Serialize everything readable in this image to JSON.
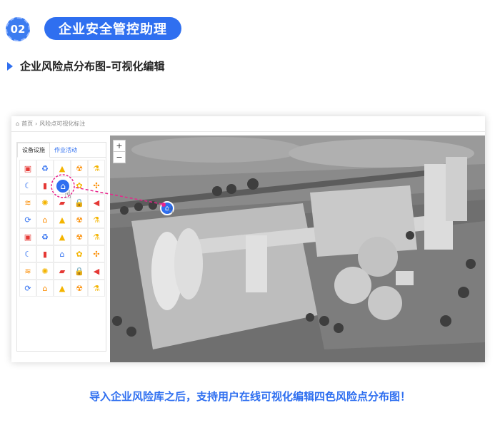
{
  "header": {
    "number": "02",
    "title": "企业安全管控助理"
  },
  "section": {
    "title": "企业风险点分布图–可视化编辑"
  },
  "app": {
    "breadcrumb": {
      "home": "首页",
      "separator": "›",
      "current": "风险点可视化标注"
    },
    "tabs": [
      {
        "label": "设备设施"
      },
      {
        "label": "作业活动"
      }
    ],
    "zoom": {
      "in": "+",
      "out": "−"
    },
    "palette": [
      [
        {
          "icon": "bed-icon",
          "color": "#e53935"
        },
        {
          "icon": "recycle-icon",
          "color": "#2f6ff0"
        },
        {
          "icon": "warning-icon",
          "color": "#f4b400"
        },
        {
          "icon": "radiation-icon",
          "color": "#fb8c00"
        },
        {
          "icon": "flask-icon",
          "color": "#f4b400"
        }
      ],
      [
        {
          "icon": "moon-icon",
          "color": "#2f6ff0"
        },
        {
          "icon": "extinguisher-icon",
          "color": "#e53935"
        },
        {
          "icon": "home-icon",
          "color": "#2f6ff0"
        },
        {
          "icon": "flower-icon",
          "color": "#f4b400"
        },
        {
          "icon": "fan-icon",
          "color": "#fb8c00"
        }
      ],
      [
        {
          "icon": "stack-icon",
          "color": "#fb8c00"
        },
        {
          "icon": "bulb-icon",
          "color": "#f4b400"
        },
        {
          "icon": "camera-icon",
          "color": "#e53935"
        },
        {
          "icon": "lock-icon",
          "color": "#2f6ff0"
        },
        {
          "icon": "speaker-icon",
          "color": "#e53935"
        }
      ],
      [
        {
          "icon": "cycle-icon",
          "color": "#2f6ff0"
        },
        {
          "icon": "house-icon",
          "color": "#fb8c00"
        },
        {
          "icon": "warning-icon",
          "color": "#f4b400"
        },
        {
          "icon": "radiation-icon",
          "color": "#fb8c00"
        },
        {
          "icon": "flask-icon",
          "color": "#f4b400"
        }
      ],
      [
        {
          "icon": "bed-icon",
          "color": "#e53935"
        },
        {
          "icon": "recycle-icon",
          "color": "#2f6ff0"
        },
        {
          "icon": "warning-icon",
          "color": "#f4b400"
        },
        {
          "icon": "radiation-icon",
          "color": "#fb8c00"
        },
        {
          "icon": "flask-icon",
          "color": "#f4b400"
        }
      ],
      [
        {
          "icon": "moon-icon",
          "color": "#2f6ff0"
        },
        {
          "icon": "extinguisher-icon",
          "color": "#e53935"
        },
        {
          "icon": "home-icon",
          "color": "#2f6ff0"
        },
        {
          "icon": "flower-icon",
          "color": "#f4b400"
        },
        {
          "icon": "fan-icon",
          "color": "#fb8c00"
        }
      ],
      [
        {
          "icon": "stack-icon",
          "color": "#fb8c00"
        },
        {
          "icon": "bulb-icon",
          "color": "#f4b400"
        },
        {
          "icon": "camera-icon",
          "color": "#e53935"
        },
        {
          "icon": "lock-icon",
          "color": "#2f6ff0"
        },
        {
          "icon": "speaker-icon",
          "color": "#e53935"
        }
      ],
      [
        {
          "icon": "cycle-icon",
          "color": "#2f6ff0"
        },
        {
          "icon": "house-icon",
          "color": "#fb8c00"
        },
        {
          "icon": "warning-icon",
          "color": "#f4b400"
        },
        {
          "icon": "radiation-icon",
          "color": "#fb8c00"
        },
        {
          "icon": "flask-icon",
          "color": "#f4b400"
        }
      ]
    ],
    "drag_accent": "#e8248c"
  },
  "caption": "导入企业风险库之后，支持用户在线可视化编辑四色风险点分布图！"
}
